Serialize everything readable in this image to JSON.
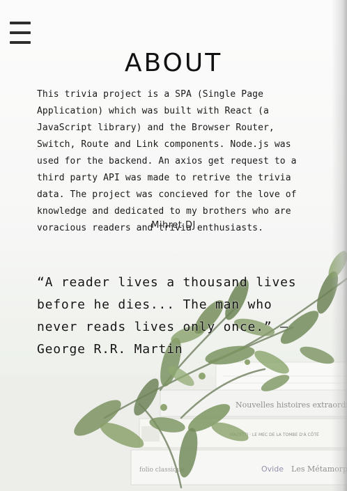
{
  "nav": {
    "menu_icon": "hamburger-menu-icon"
  },
  "about": {
    "title": "ABOUT",
    "description": "This trivia project is a SPA (Single Page Application) which was built with React (a JavaScript library) and the Browser Router, Switch, Route and Link components. Node.js was used for the backend. An axios get request to a third party API was made to retrive the trivia data. The project was concieved for the love of knowledge and dedicated to my brothers who are voracious readers and trivia enthusiasts.",
    "author": "Mihret DJ"
  },
  "quote": {
    "text": "“A reader lives a thousand lives before he dies... The man who never reads lives only once.” — George R.R. Martin"
  },
  "background": {
    "book_spine_1": "Nouvelles histoires extraordinai",
    "book_spine_2": "MAZETTI · LE MEC DE LA TOMBE D'À CÔTÉ",
    "book_spine_3_author": "Ovide",
    "book_spine_3_title": "Les Métamorph",
    "book_spine_3_publisher": "folio classique"
  }
}
